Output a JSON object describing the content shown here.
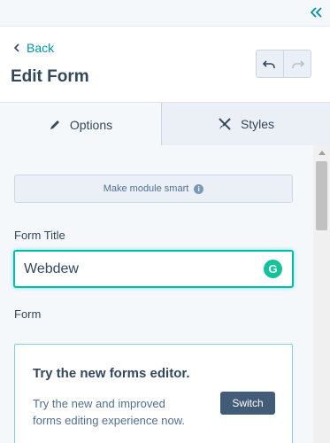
{
  "topbar": {
    "collapse_icon": "double-chevron-left-icon"
  },
  "header": {
    "back_label": "Back",
    "title": "Edit Form",
    "undo_icon": "undo-icon",
    "redo_icon": "redo-icon"
  },
  "tabs": [
    {
      "label": "Options",
      "icon": "pencil-icon",
      "active": true
    },
    {
      "label": "Styles",
      "icon": "brush-icon",
      "active": false
    }
  ],
  "panel": {
    "smart_button_label": "Make module smart",
    "form_title_label": "Form Title",
    "form_title_value": "Webdew",
    "form_label": "Form",
    "card": {
      "title": "Try the new forms editor.",
      "body": "Try the new and improved forms editing experience now.",
      "button_label": "Switch"
    }
  },
  "colors": {
    "accent": "#0091ae",
    "input_focus": "#00bda5",
    "button_dark": "#425b76",
    "grammarly": "#15c39a"
  }
}
